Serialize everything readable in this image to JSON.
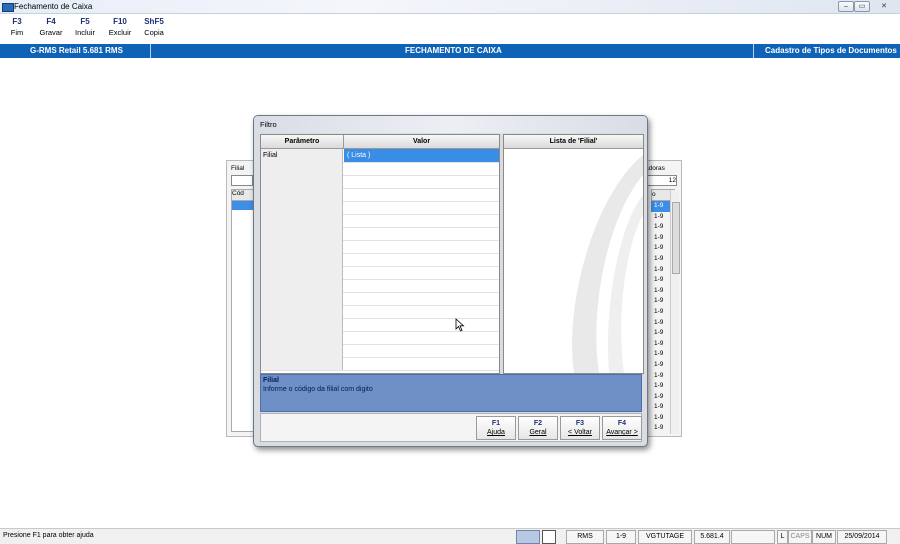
{
  "window": {
    "title": "Fechamento de Caixa",
    "min": "–",
    "max": "▭",
    "close": "✕"
  },
  "fkeys": [
    {
      "key": "F3",
      "label": "Fim"
    },
    {
      "key": "F4",
      "label": "Gravar"
    },
    {
      "key": "F5",
      "label": "Incluir"
    },
    {
      "key": "F10",
      "label": "Excluir"
    },
    {
      "key": "ShF5",
      "label": "Copia"
    }
  ],
  "header": {
    "app": "G-RMS Retail 5.681 RMS",
    "screen": "FECHAMENTO DE CAIXA",
    "module": "Cadastro de Tipos de Documentos"
  },
  "background_form": {
    "filial_label": "Filial",
    "code_header": "Cód",
    "right_label": "adoras",
    "right_value": "12",
    "right_col_header": "o",
    "right_values": [
      "1-9",
      "1-9",
      "1-9",
      "1-9",
      "1-9",
      "1-9",
      "1-9",
      "1-9",
      "1-9",
      "1-9",
      "1-9",
      "1-9",
      "1-9",
      "1-9",
      "1-9",
      "1-9",
      "1-9",
      "1-9",
      "1-9",
      "1-9",
      "1-9",
      "1-9"
    ]
  },
  "dialog": {
    "title": "Filtro",
    "col_param": "Parâmetro",
    "col_value": "Valor",
    "rows": [
      {
        "param": "Filial",
        "value": "( Lista )"
      },
      {
        "param": "",
        "value": ""
      },
      {
        "param": "",
        "value": ""
      },
      {
        "param": "",
        "value": ""
      },
      {
        "param": "",
        "value": ""
      },
      {
        "param": "",
        "value": ""
      },
      {
        "param": "",
        "value": ""
      },
      {
        "param": "",
        "value": ""
      },
      {
        "param": "",
        "value": ""
      },
      {
        "param": "",
        "value": ""
      },
      {
        "param": "",
        "value": ""
      },
      {
        "param": "",
        "value": ""
      },
      {
        "param": "",
        "value": ""
      },
      {
        "param": "",
        "value": ""
      },
      {
        "param": "",
        "value": ""
      },
      {
        "param": "",
        "value": ""
      },
      {
        "param": "",
        "value": ""
      }
    ],
    "list_header": "Lista de 'Filial'",
    "help_title": "Filial",
    "help_text": "Informe o código da filial com digito",
    "buttons": [
      {
        "key": "F1",
        "label": "Ajuda"
      },
      {
        "key": "F2",
        "label": "Geral"
      },
      {
        "key": "F3",
        "label": "< Voltar"
      },
      {
        "key": "F4",
        "label": "Avançar >"
      }
    ]
  },
  "status": {
    "hint": "Presione F1 para obter ajuda",
    "fields": [
      "RMS",
      "1-9",
      "VGTUTAGE",
      "5.681.4",
      "",
      "L",
      "CAPS",
      "NUM",
      "25/09/2014"
    ]
  },
  "colors": {
    "accent": "#0f63b6",
    "selection": "#3a8de4",
    "help_bg": "#6f90c6"
  }
}
